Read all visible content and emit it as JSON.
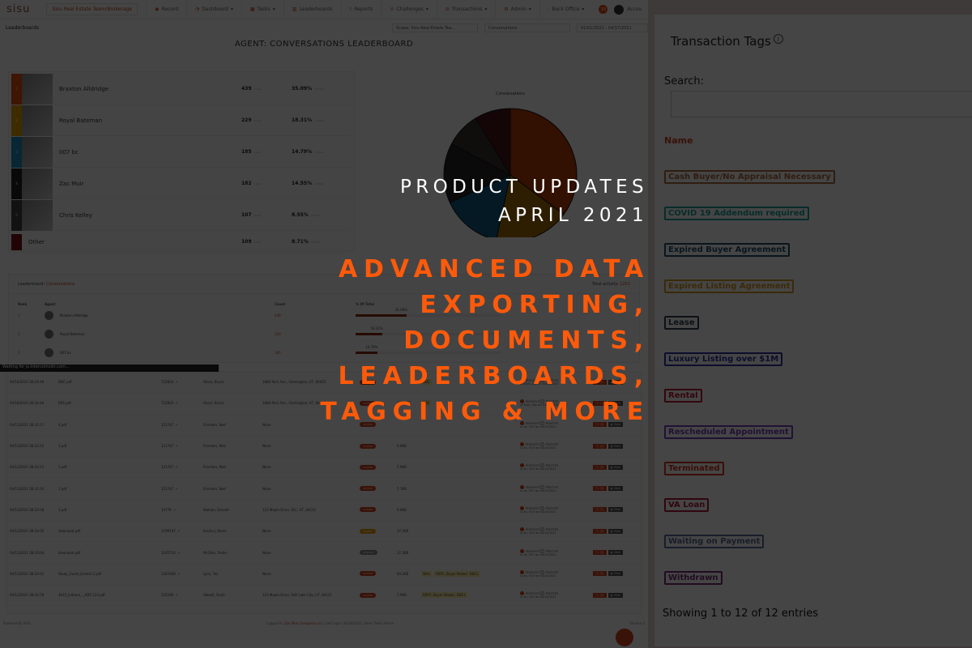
{
  "app": {
    "logo": "sisu",
    "team_selector": "Sisu Real Estate Team/Brokerage",
    "nav": [
      {
        "label": "Record",
        "icon": "record-icon"
      },
      {
        "label": "Dashboard",
        "icon": "dashboard-icon"
      },
      {
        "label": "Tasks",
        "icon": "tasks-icon"
      },
      {
        "label": "Leaderboards",
        "icon": "leaderboards-icon"
      },
      {
        "label": "Reports",
        "icon": "reports-icon"
      },
      {
        "label": "Challenges",
        "icon": "trophy-icon"
      },
      {
        "label": "Transactions",
        "icon": "transactions-icon"
      },
      {
        "label": "Admin",
        "icon": "gear-icon"
      },
      {
        "label": "Back Office",
        "icon": "sliders-icon"
      }
    ],
    "notification_count": "10",
    "account_label": "Accou",
    "breadcrumb": "Leaderboards",
    "scope_select": "Scope: Sisu Real Estate Tea...",
    "metric_select": "Conversations",
    "date_range": "01/01/2021 - 04/17/2021",
    "leaderboard_title": "AGENT: CONVERSATIONS LEADERBOARD",
    "top_agents": [
      {
        "rank": "1",
        "name": "Braxton Alldridge",
        "count": "439",
        "percent": "35.09%",
        "color": "#e84c0e"
      },
      {
        "rank": "2",
        "name": "Royal Bateman",
        "count": "229",
        "percent": "18.31%",
        "color": "#e9a100"
      },
      {
        "rank": "3",
        "name": "007 bc",
        "count": "185",
        "percent": "14.79%",
        "color": "#1b8fbf"
      },
      {
        "rank": "4",
        "name": "Zac Muir",
        "count": "182",
        "percent": "14.55%",
        "color": "#222222"
      },
      {
        "rank": "5",
        "name": "Chris Kelley",
        "count": "107",
        "percent": "8.55%",
        "color": "#444444"
      },
      {
        "rank": "",
        "name": "Other",
        "count": "109",
        "percent": "8.71%",
        "color": "#7a1116"
      }
    ],
    "count_suffix": "Count",
    "percent_suffix": "of Total",
    "pie_title": "Conversations",
    "board": {
      "label": "Leaderboard:",
      "metric": "Conversations",
      "total_label": "Total activity:",
      "total_value": "1251",
      "columns": [
        "Rank",
        "Agent",
        "Count",
        "% Of Total"
      ],
      "rows": [
        {
          "rank": "1",
          "agent": "Braxton Alldridge",
          "count": "439",
          "percent": "35.09%",
          "fraction": 0.3509
        },
        {
          "rank": "2",
          "agent": "Royal Bateman",
          "count": "229",
          "percent": "18.31%",
          "fraction": 0.1831
        },
        {
          "rank": "3",
          "agent": "007 bc",
          "count": "185",
          "percent": "14.79%",
          "fraction": 0.1479
        }
      ]
    },
    "status_bar": "Waiting for js.intercomcdn.com...",
    "documents": [
      {
        "date": "04/18/2021 00:24:49",
        "file": "DDC.pdf",
        "id": "722820",
        "agent": "Olsen, Bryce",
        "address": "1884 Park Ave., Farmington, UT, 84025",
        "status": "CLOSED",
        "size": "",
        "tags": [
          "DDC"
        ],
        "approver": "Muir, Zac on 04/18/2021",
        "comments": "(1)",
        "view": "View"
      },
      {
        "date": "04/18/2021 00:24:44",
        "file": "ERS.pdf",
        "id": "722820",
        "agent": "Olsen, Bryce",
        "address": "1884 Park Ave., Farmington, UT, 84025",
        "status": "CLOSED",
        "size": "125.3KB",
        "tags": [
          "ERS"
        ],
        "approver": "Muir, Zac on 04/18/2021",
        "comments": "(1)",
        "view": "View"
      },
      {
        "date": "04/13/2021 08:33:17",
        "file": "4.pdf",
        "id": "121747",
        "agent": "Flanders, Ned",
        "address": "None",
        "status": "CLOSED",
        "size": "",
        "tags": [],
        "approver": "bc, 007 on 04/13/2021",
        "comments": "(0)",
        "view": "View"
      },
      {
        "date": "04/13/2021 08:33:15",
        "file": "3.pdf",
        "id": "121747",
        "agent": "Flanders, Ned",
        "address": "None",
        "status": "CLOSED",
        "size": "6.0KB",
        "tags": [],
        "approver": "bc, 007 on 04/13/2021",
        "comments": "(0)",
        "view": "View"
      },
      {
        "date": "04/13/2021 08:33:13",
        "file": "2.pdf",
        "id": "121747",
        "agent": "Flanders, Ned",
        "address": "None",
        "status": "CLOSED",
        "size": "5.9KB",
        "tags": [],
        "approver": "bc, 007 on 04/13/2021",
        "comments": "(0)",
        "view": "View"
      },
      {
        "date": "04/13/2021 08:33:10",
        "file": "1.pdf",
        "id": "121747",
        "agent": "Flanders, Ned",
        "address": "None",
        "status": "CLOSED",
        "size": "5.7KB",
        "tags": [],
        "approver": "bc, 007 on 04/13/2021",
        "comments": "(0)",
        "view": "View"
      },
      {
        "date": "04/13/2021 08:33:08",
        "file": "3.pdf",
        "id": "34778",
        "agent": "Watson, Donald",
        "address": "123 Maple Drive, SLC, UT, 84121",
        "status": "CLOSED",
        "size": "6.0KB",
        "tags": [],
        "approver": "bc, 007 on 04/13/2021",
        "comments": "(1)",
        "view": "View"
      },
      {
        "date": "04/13/2021 08:33:05",
        "file": "download.pdf",
        "id": "1196197",
        "agent": "Kaufusi, Devin",
        "address": "None",
        "status": "SIGNED",
        "size": "37.2KB",
        "tags": [],
        "approver": "bc, 007 on 04/13/2021",
        "comments": "(0)",
        "view": "View"
      },
      {
        "date": "04/13/2021 08:33:04",
        "file": "download.pdf",
        "id": "1165710",
        "agent": "McGhie, Tester",
        "address": "None",
        "status": "PENDING",
        "size": "37.2KB",
        "tags": [],
        "approver": "bc, 007 on 04/13/2021",
        "comments": "(0)",
        "view": "View"
      },
      {
        "date": "04/13/2021 08:33:01",
        "file": "Study_Guide_Exam2-2.pdf",
        "id": "1303369",
        "agent": "Lynn, Tes",
        "address": "None",
        "status": "CLOSED",
        "size": "69.2KB",
        "tags": [
          "Wire",
          "REPC, Buyer Broker, DDCL"
        ],
        "approver": "bc, 007 on 04/13/2021",
        "comments": "(0)",
        "view": "View"
      },
      {
        "date": "04/13/2021 08:32:59",
        "file": "4615_Indiana_-_ADR 123.pdf",
        "id": "255196",
        "agent": "Abbott, Scott",
        "address": "123 Maple Drive, Salt Lake City, UT, 84121",
        "status": "CLOSED",
        "size": "1.9KB",
        "tags": [
          "REPC, Buyer Broker, DDCL"
        ],
        "approver": "bc, 007 on 04/13/2021",
        "comments": "(0)",
        "view": "View"
      }
    ],
    "approved_label": "Approved",
    "rejected_label": "Rejected",
    "footer_left": "Powered By SISU",
    "footer_center_prefix": "Logged In:",
    "footer_user": "Zac Muir (zac@sisu.co)",
    "footer_center_suffix": "| Last login: 04/18/2021 | Role: Team Admin",
    "footer_right": "Version 3"
  },
  "tags_panel": {
    "title": "Transaction Tags",
    "search_label": "Search:",
    "search_value": "",
    "column_header": "Name",
    "tags": [
      {
        "name": "Cash Buyer/No Appraisal Necessary",
        "color": "#b06a3a"
      },
      {
        "name": "COVID 19 Addendum required",
        "color": "#1aa39a"
      },
      {
        "name": "Expired Buyer Agreement",
        "color": "#1f4e6e"
      },
      {
        "name": "Expired Listing Agreement",
        "color": "#d99a1c"
      },
      {
        "name": "Lease",
        "color": "#2f3f52"
      },
      {
        "name": "Luxury Listing over $1M",
        "color": "#2b2fa6"
      },
      {
        "name": "Rental",
        "color": "#c0182b"
      },
      {
        "name": "Rescheduled Appointment",
        "color": "#7a3fc4"
      },
      {
        "name": "Terminated",
        "color": "#d8331a"
      },
      {
        "name": "VA Loan",
        "color": "#b0183c"
      },
      {
        "name": "Waiting on Payment",
        "color": "#5a6a9a"
      },
      {
        "name": "Withdrawn",
        "color": "#7a2a7a"
      }
    ],
    "footer": "Showing 1 to 12 of 12 entries"
  },
  "headline": {
    "line1": "PRODUCT UPDATES",
    "line2": "APRIL 2021",
    "features": [
      "ADVANCED DATA",
      "EXPORTING,",
      "DOCUMENTS,",
      "LEADERBOARDS,",
      "TAGGING & MORE"
    ],
    "accent_color": "#ff5a0a"
  }
}
